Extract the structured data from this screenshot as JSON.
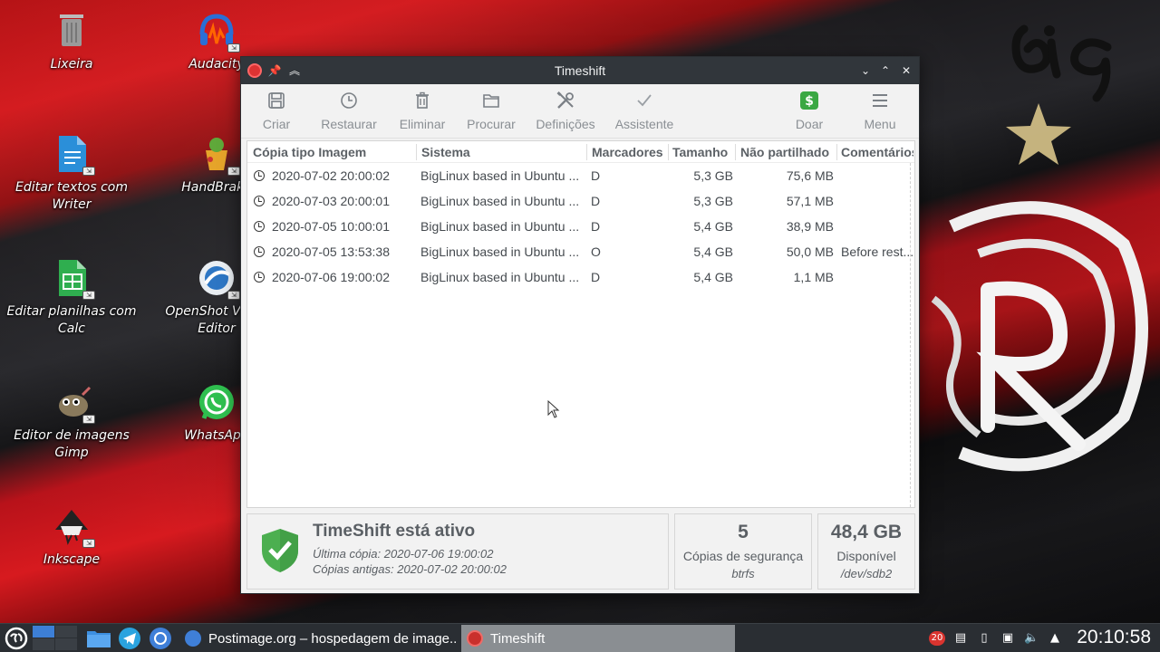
{
  "desktop": {
    "icons": [
      {
        "label": "Lixeira"
      },
      {
        "label": "Audacity"
      },
      {
        "label": "Editar textos com Writer"
      },
      {
        "label": "HandBrake"
      },
      {
        "label": "Editar planilhas com Calc"
      },
      {
        "label": "OpenShot Video Editor"
      },
      {
        "label": "Editor de imagens Gimp"
      },
      {
        "label": "WhatsApp"
      },
      {
        "label": "Inkscape"
      }
    ]
  },
  "window": {
    "title": "Timeshift",
    "toolbar": {
      "criar": "Criar",
      "restaurar": "Restaurar",
      "eliminar": "Eliminar",
      "procurar": "Procurar",
      "definicoes": "Definições",
      "assistente": "Assistente",
      "doar": "Doar",
      "menu": "Menu"
    },
    "columns": {
      "snapshot": "Cópia tipo Imagem",
      "system": "Sistema",
      "tags": "Marcadores",
      "size": "Tamanho",
      "unshared": "Não partilhado",
      "comments": "Comentários"
    },
    "rows": [
      {
        "date": "2020-07-02 20:00:02",
        "system": "BigLinux based in Ubuntu ...",
        "tag": "D",
        "size": "5,3 GB",
        "unshared": "75,6 MB",
        "comment": ""
      },
      {
        "date": "2020-07-03 20:00:01",
        "system": "BigLinux based in Ubuntu ...",
        "tag": "D",
        "size": "5,3 GB",
        "unshared": "57,1 MB",
        "comment": ""
      },
      {
        "date": "2020-07-05 10:00:01",
        "system": "BigLinux based in Ubuntu ...",
        "tag": "D",
        "size": "5,4 GB",
        "unshared": "38,9 MB",
        "comment": ""
      },
      {
        "date": "2020-07-05 13:53:38",
        "system": "BigLinux based in Ubuntu ...",
        "tag": "O",
        "size": "5,4 GB",
        "unshared": "50,0 MB",
        "comment": "Before rest..."
      },
      {
        "date": "2020-07-06 19:00:02",
        "system": "BigLinux based in Ubuntu ...",
        "tag": "D",
        "size": "5,4 GB",
        "unshared": "1,1 MB",
        "comment": ""
      }
    ],
    "status": {
      "title": "TimeShift está ativo",
      "last": "Última cópia: 2020-07-06 19:00:02",
      "oldest": "Cópias antigas: 2020-07-02 20:00:02"
    },
    "count_box": {
      "value": "5",
      "label": "Cópias de segurança",
      "sub": "btrfs"
    },
    "space_box": {
      "value": "48,4 GB",
      "label": "Disponível",
      "sub": "/dev/sdb2"
    }
  },
  "taskbar": {
    "tasks": [
      {
        "label": "Postimage.org – hospedagem de image..."
      },
      {
        "label": "Timeshift"
      }
    ],
    "notifications": "20",
    "clock": "20:10:58"
  },
  "colors": {
    "titlebar": "#31363b",
    "taskbar": "#2a2e33",
    "shield_green": "#4caf50",
    "doar_green": "#3aa843"
  }
}
